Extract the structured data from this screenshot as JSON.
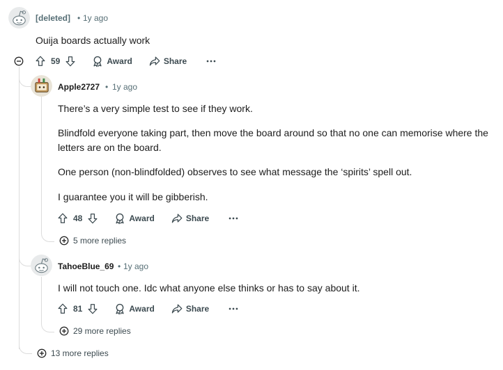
{
  "comments": {
    "root": {
      "author": "[deleted]",
      "time": "1y ago",
      "body": "Ouija boards actually work",
      "score": "59",
      "award_label": "Award",
      "share_label": "Share",
      "more_replies": "13 more replies"
    },
    "reply1": {
      "author": "Apple2727",
      "time": "1y ago",
      "paragraphs": [
        "There’s a very simple test to see if they work.",
        "Blindfold everyone taking part, then move the board around so that no one can memorise where the letters are on the board.",
        "One person (non-blindfolded) observes to see what message the ‘spirits’ spell out.",
        "I guarantee you it will be gibberish."
      ],
      "score": "48",
      "award_label": "Award",
      "share_label": "Share",
      "more_replies": "5 more replies"
    },
    "reply2": {
      "author": "TahoeBlue_69",
      "time": "1y ago",
      "body": "I will not touch one. Idc what anyone else thinks or has to say about it.",
      "score": "81",
      "award_label": "Award",
      "share_label": "Share",
      "more_replies": "29 more replies"
    }
  },
  "separator": "•",
  "icons": {
    "upvote": "upvote-icon",
    "downvote": "downvote-icon",
    "award": "award-icon",
    "share": "share-icon",
    "more": "more-options-icon",
    "collapse": "collapse-icon",
    "expand": "expand-icon"
  },
  "colors": {
    "meta": "#576f76",
    "text": "#1c1c1c",
    "thread": "#dcdcdc"
  }
}
